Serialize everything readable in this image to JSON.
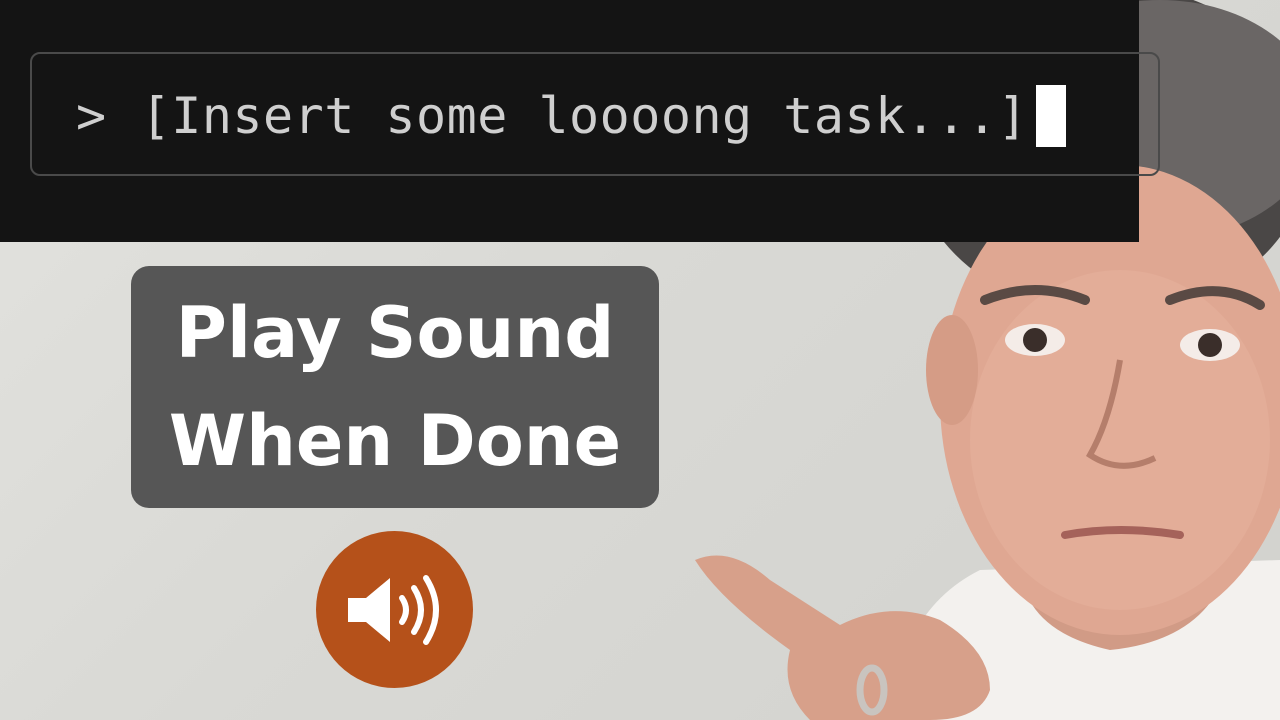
{
  "terminal": {
    "prompt_symbol": ">",
    "input_text": "[Insert some loooong task...]"
  },
  "caption": {
    "line1": "Play Sound",
    "line2": "When Done"
  },
  "speaker": {
    "icon": "speaker-volume-icon",
    "color": "#b5511a"
  },
  "colors": {
    "terminal_bg": "#141414",
    "caption_bg": "#565656",
    "caption_text": "#ffffff"
  }
}
